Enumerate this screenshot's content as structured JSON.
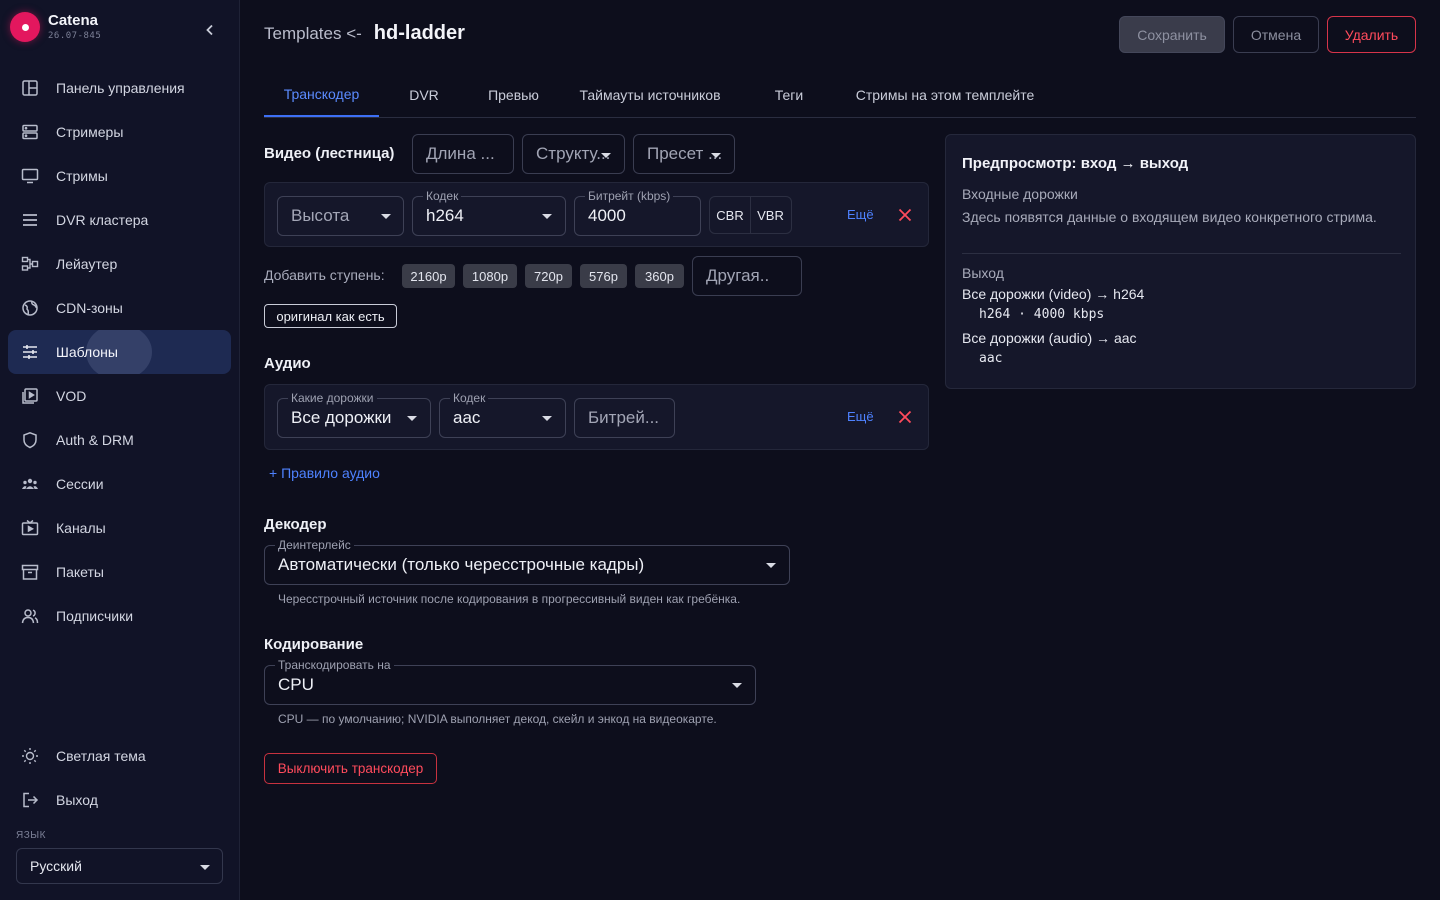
{
  "brand": {
    "name": "Catena",
    "version": "26.07-845"
  },
  "nav": {
    "items": [
      {
        "label": "Панель управления",
        "icon": "dashboard-icon"
      },
      {
        "label": "Стримеры",
        "icon": "server-icon"
      },
      {
        "label": "Стримы",
        "icon": "monitor-icon"
      },
      {
        "label": "DVR кластера",
        "icon": "storage-icon"
      },
      {
        "label": "Лейаутер",
        "icon": "layout-icon"
      },
      {
        "label": "CDN-зоны",
        "icon": "globe-icon"
      },
      {
        "label": "Шаблоны",
        "icon": "sliders-icon",
        "active": true
      },
      {
        "label": "VOD",
        "icon": "video-library-icon"
      },
      {
        "label": "Auth & DRM",
        "icon": "shield-icon"
      },
      {
        "label": "Сессии",
        "icon": "users-group-icon"
      },
      {
        "label": "Каналы",
        "icon": "tv-icon"
      },
      {
        "label": "Пакеты",
        "icon": "archive-icon"
      },
      {
        "label": "Подписчики",
        "icon": "user-icon"
      }
    ],
    "theme_label": "Светлая тема",
    "logout_label": "Выход",
    "language_label": "ЯЗЫК",
    "language_value": "Русский"
  },
  "header": {
    "breadcrumb": "Templates <-",
    "title": "hd-ladder",
    "save_label": "Сохранить",
    "cancel_label": "Отмена",
    "delete_label": "Удалить"
  },
  "tabs": [
    "Транскодер",
    "DVR",
    "Превью",
    "Таймауты источников",
    "Теги",
    "Стримы на этом темплейте"
  ],
  "video": {
    "title": "Видео (лестница)",
    "length_placeholder": "Длина ...",
    "structure_placeholder": "Структу...",
    "preset_placeholder": "Пресет ...",
    "height_placeholder": "Высота",
    "codec_label": "Кодек",
    "codec_value": "h264",
    "bitrate_label": "Битрейт (kbps)",
    "bitrate_value": "4000",
    "cbr": "CBR",
    "vbr": "VBR",
    "more": "Ещё",
    "add_steps_label": "Добавить ступень:",
    "steps": [
      "2160p",
      "1080p",
      "720p",
      "576p",
      "360p"
    ],
    "other_placeholder": "Другая..",
    "original_label": "оригинал как есть"
  },
  "audio": {
    "title": "Аудио",
    "tracks_label": "Какие дорожки",
    "tracks_value": "Все дорожки",
    "codec_label": "Кодек",
    "codec_value": "aac",
    "bitrate_placeholder": "Битрей...",
    "more": "Ещё",
    "add_rule": "+ Правило аудио"
  },
  "decoder": {
    "title": "Декодер",
    "deinterlace_label": "Деинтерлейс",
    "deinterlace_value": "Автоматически (только чересстрочные кадры)",
    "helper": "Чересстрочный источник после кодирования в прогрессивный виден как гребёнка."
  },
  "encoding": {
    "title": "Кодирование",
    "transcode_label": "Транскодировать на",
    "transcode_value": "CPU",
    "helper": "CPU — по умолчанию; NVIDIA выполняет декод, скейл и энкод на видеокарте."
  },
  "disable_transcoder": "Выключить транскодер",
  "preview": {
    "title": "Предпросмотр: вход → выход",
    "input_title": "Входные дорожки",
    "input_text": "Здесь появятся данные о входящем видео конкретного стрима.",
    "output_title": "Выход",
    "video_line": "Все дорожки (video) → h264",
    "video_detail": "h264 · 4000 kbps",
    "audio_line": "Все дорожки (audio) → aac",
    "audio_detail": "aac"
  },
  "colors": {
    "accent": "#3d6ff5",
    "danger": "#ff4b5c",
    "brand": "#e3175e",
    "background": "#0d0e1c"
  }
}
